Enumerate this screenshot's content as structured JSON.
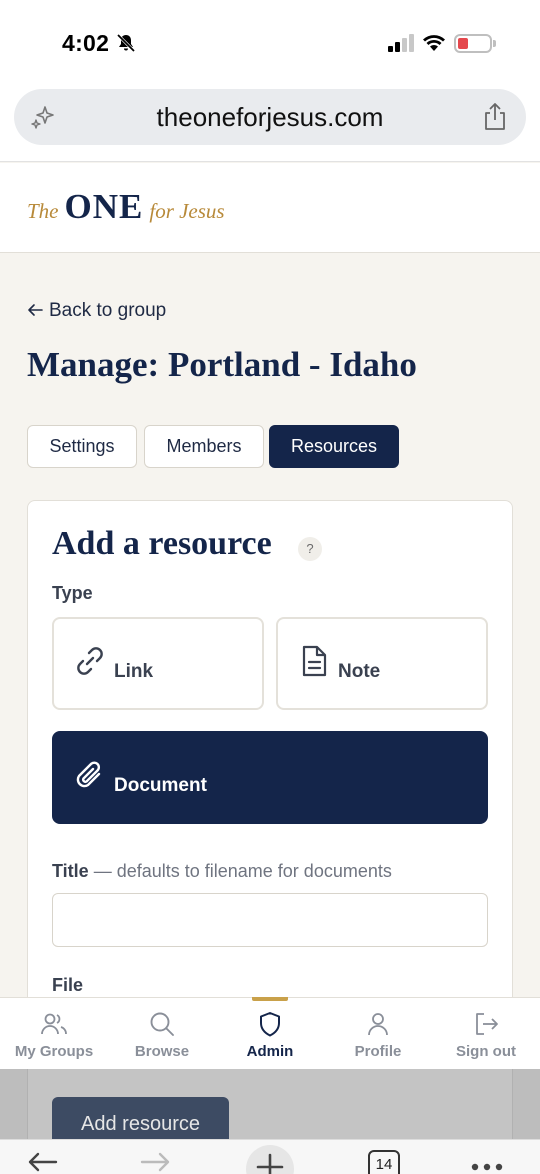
{
  "status": {
    "time": "4:02",
    "battery": "18"
  },
  "browser": {
    "url": "theoneforjesus.com",
    "tab_count": "14"
  },
  "site": {
    "logo_pre": "The",
    "logo_main": "ONE",
    "logo_post": "for Jesus"
  },
  "page": {
    "back_label": "Back to group",
    "title": "Manage: Portland - Idaho",
    "tabs": [
      {
        "label": "Settings",
        "active": false
      },
      {
        "label": "Members",
        "active": false
      },
      {
        "label": "Resources",
        "active": true
      }
    ]
  },
  "form": {
    "heading": "Add a resource",
    "help": "?",
    "type_label": "Type",
    "types": [
      {
        "label": "Link",
        "icon": "link-icon",
        "selected": false
      },
      {
        "label": "Note",
        "icon": "document-icon",
        "selected": false
      },
      {
        "label": "Document",
        "icon": "paperclip-icon",
        "selected": true
      }
    ],
    "title_label": "Title",
    "title_hint": "— defaults to filename for documents",
    "title_value": "",
    "file_label": "File",
    "submit_label": "Add resource"
  },
  "nav": [
    {
      "label": "My Groups",
      "icon": "users-icon",
      "active": false
    },
    {
      "label": "Browse",
      "icon": "search-icon",
      "active": false
    },
    {
      "label": "Admin",
      "icon": "shield-icon",
      "active": true
    },
    {
      "label": "Profile",
      "icon": "user-icon",
      "active": false
    },
    {
      "label": "Sign out",
      "icon": "sign-out-icon",
      "active": false
    }
  ],
  "colors": {
    "navy": "#14254a",
    "gold": "#c9a14a",
    "background": "#f6f4ef"
  }
}
